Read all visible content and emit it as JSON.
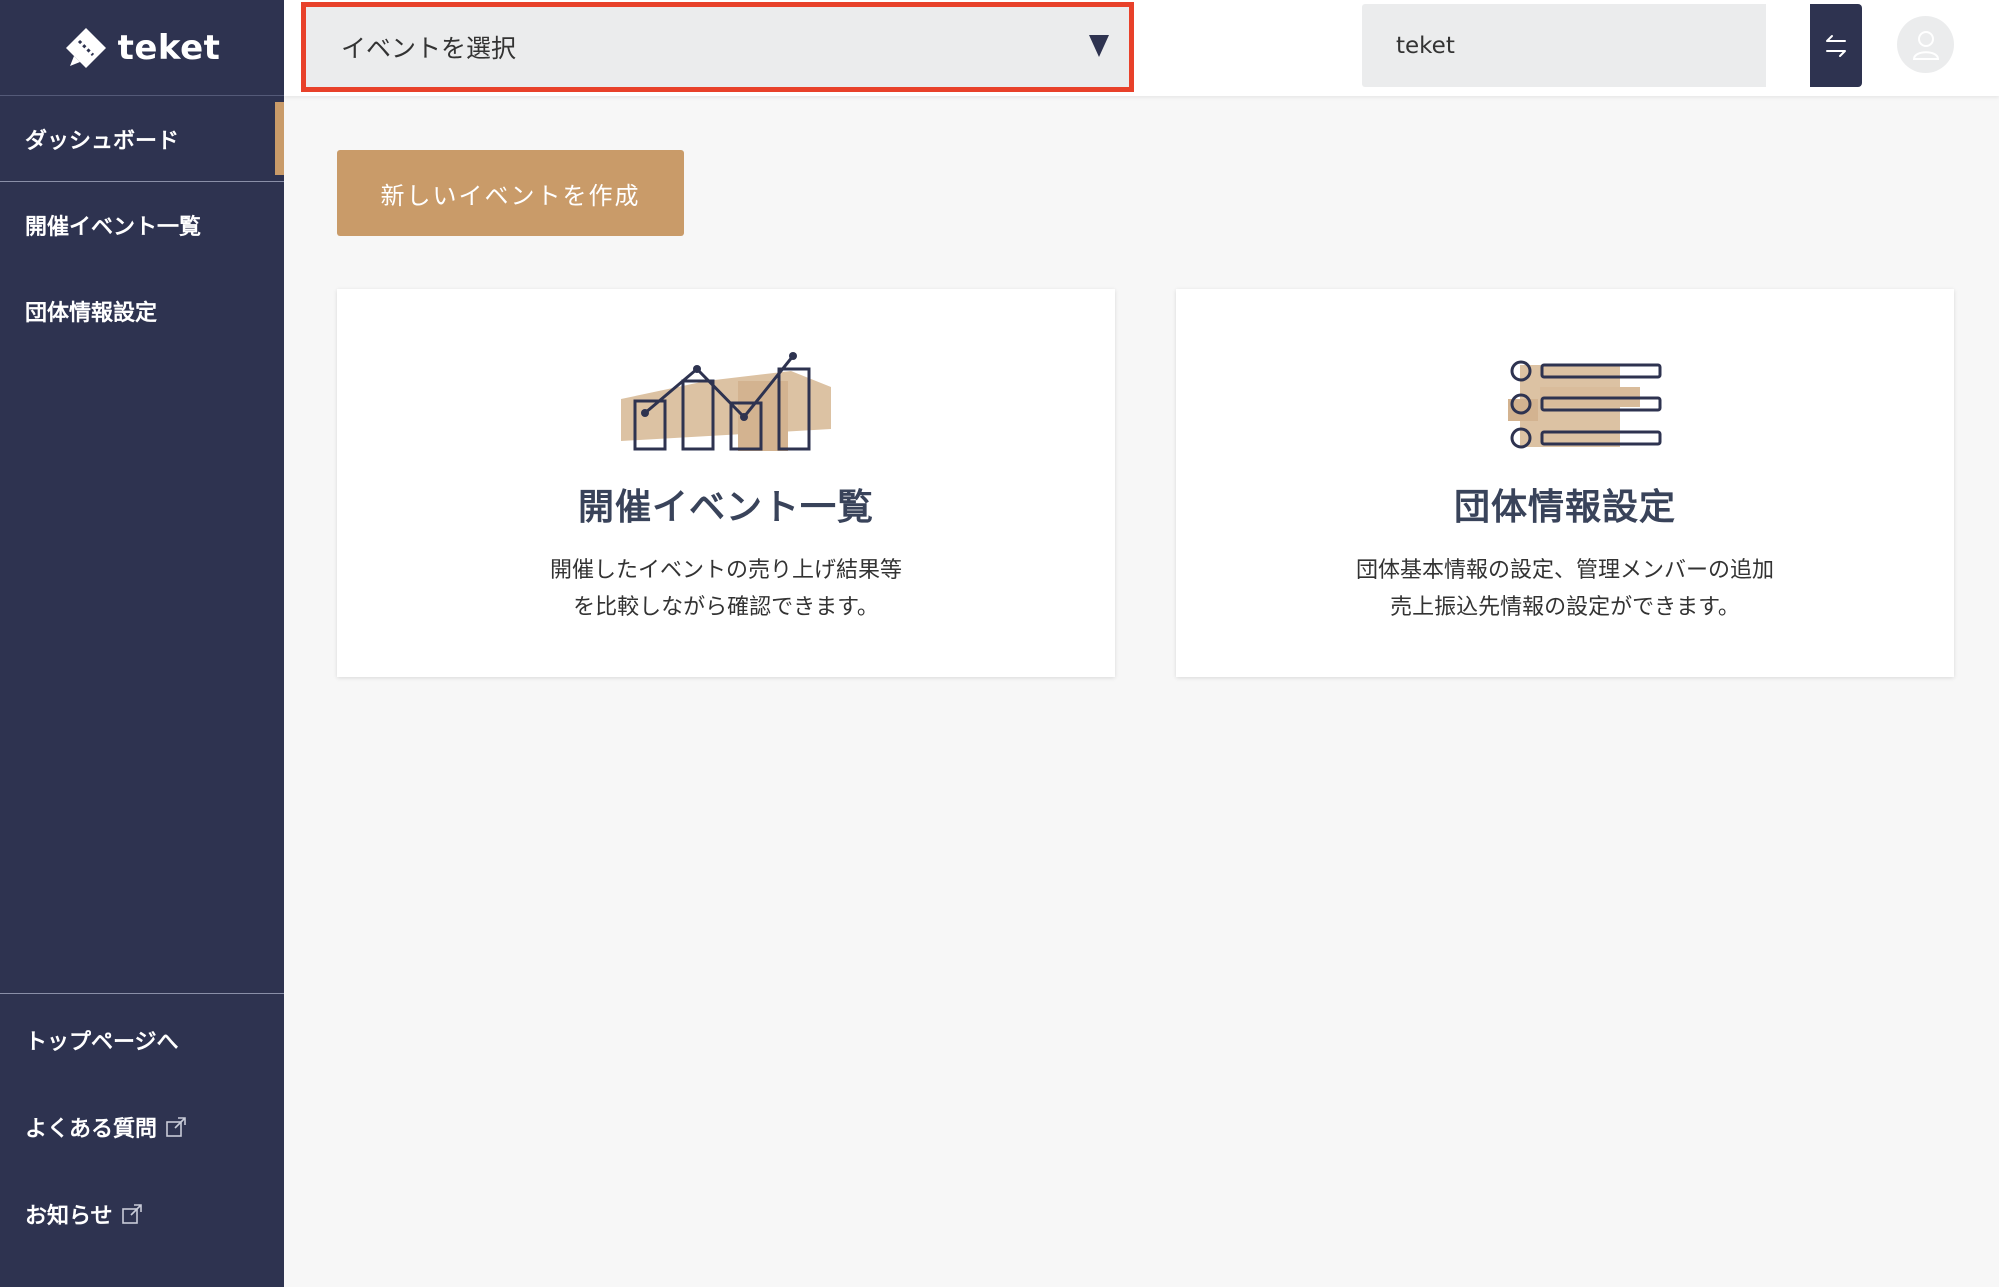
{
  "brand": {
    "name": "teket"
  },
  "colors": {
    "sidebar": "#2e3350",
    "accent": "#c99b69",
    "highlight_border": "#e8412a",
    "card_title": "#39435a"
  },
  "sidebar": {
    "items": [
      {
        "label": "ダッシュボード",
        "active": true
      },
      {
        "label": "開催イベント一覧"
      },
      {
        "label": "団体情報設定"
      }
    ],
    "bottom_items": [
      {
        "label": "トップページへ"
      },
      {
        "label": "よくある質問",
        "icon": "external-link-icon"
      },
      {
        "label": "お知らせ",
        "icon": "external-link-icon"
      }
    ]
  },
  "header": {
    "event_select": {
      "placeholder": "イベントを選択"
    },
    "organization": {
      "name": "teket"
    },
    "icons": [
      "swap-arrows-icon",
      "user-icon"
    ]
  },
  "main": {
    "new_event_button": "新しいイベントを作成",
    "cards": [
      {
        "title": "開催イベント一覧",
        "description": "開催したイベントの売り上げ結果等\nを比較しながら確認できます。",
        "icon": "chart-illustration-icon"
      },
      {
        "title": "団体情報設定",
        "description": "団体基本情報の設定、管理メンバーの追加\n売上振込先情報の設定ができます。",
        "icon": "list-illustration-icon"
      }
    ]
  }
}
